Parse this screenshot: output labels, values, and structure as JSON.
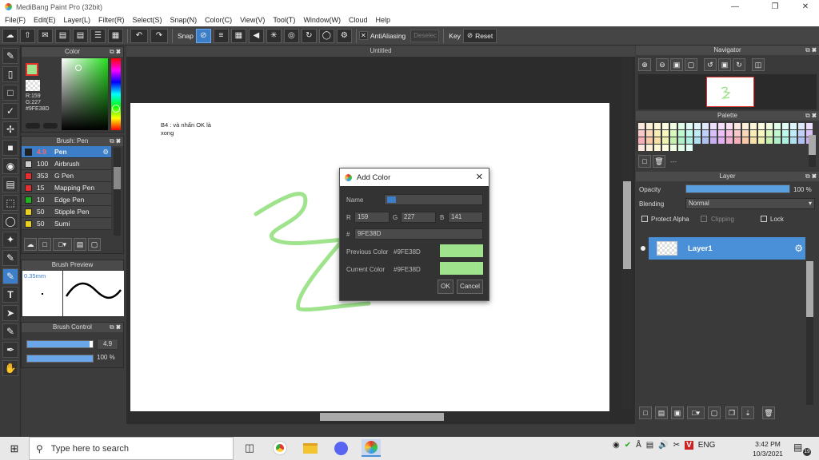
{
  "app": {
    "title": "MediBang Paint Pro (32bit)"
  },
  "menu": [
    "File(F)",
    "Edit(E)",
    "Layer(L)",
    "Filter(R)",
    "Select(S)",
    "Snap(N)",
    "Color(C)",
    "View(V)",
    "Tool(T)",
    "Window(W)",
    "Cloud",
    "Help"
  ],
  "toolbar": {
    "snap_label": "Snap",
    "antialias_label": "AntiAliasing",
    "deselect_label": "Deselec",
    "key_label": "Key",
    "reset_label": "Reset"
  },
  "color_panel": {
    "title": "Color",
    "r": "R:159",
    "g": "G:227",
    "hex": "#9FE38D",
    "color": "#9fe38d"
  },
  "brush_panel": {
    "title": "Brush: Pen",
    "items": [
      {
        "size": "4.9",
        "name": "Pen",
        "color": "#222222"
      },
      {
        "size": "100",
        "name": "Airbrush",
        "color": "#cccccc"
      },
      {
        "size": "353",
        "name": "G Pen",
        "color": "#e03030"
      },
      {
        "size": "15",
        "name": "Mapping Pen",
        "color": "#e03030"
      },
      {
        "size": "10",
        "name": "Edge Pen",
        "color": "#20b020"
      },
      {
        "size": "50",
        "name": "Stipple Pen",
        "color": "#e8d020"
      },
      {
        "size": "50",
        "name": "Sumi",
        "color": "#e8d020"
      }
    ]
  },
  "brush_preview": {
    "title": "Brush Preview",
    "size": "0.35mm"
  },
  "brush_control": {
    "title": "Brush Control",
    "size_value": "4.9",
    "opacity_value": "100 %",
    "size_fraction": 0.95,
    "opacity_fraction": 1.0
  },
  "canvas": {
    "tab_title": "Untitled",
    "note_line1": "B4 : và nhấn OK là",
    "note_line2": "xong",
    "stroke_color": "#9fe38d"
  },
  "dialog": {
    "title": "Add Color",
    "name_label": "Name",
    "r_label": "R",
    "r_value": "159",
    "g_label": "G",
    "g_value": "227",
    "b_label": "B",
    "b_value": "141",
    "hash_label": "#",
    "hex_value": "9FE38D",
    "prev_label": "Previous Color",
    "prev_hex": "#9FE38D",
    "curr_label": "Current Color",
    "curr_hex": "#9FE38D",
    "swatch_color": "#9fe38d",
    "ok_label": "OK",
    "cancel_label": "Cancel"
  },
  "navigator": {
    "title": "Navigator"
  },
  "palette": {
    "title": "Palette",
    "extra_label": "---"
  },
  "layer_panel": {
    "title": "Layer",
    "opacity_label": "Opacity",
    "opacity_value": "100 %",
    "opacity_fraction": 1.0,
    "blending_label": "Blending",
    "blending_value": "Normal",
    "protect_alpha_label": "Protect Alpha",
    "clipping_label": "Clipping",
    "lock_label": "Lock",
    "layer_name": "Layer1"
  },
  "taskbar": {
    "search_placeholder": "Type here to search",
    "lang": "ENG",
    "time": "3:42 PM",
    "date": "10/3/2021",
    "notif_count": "19"
  }
}
